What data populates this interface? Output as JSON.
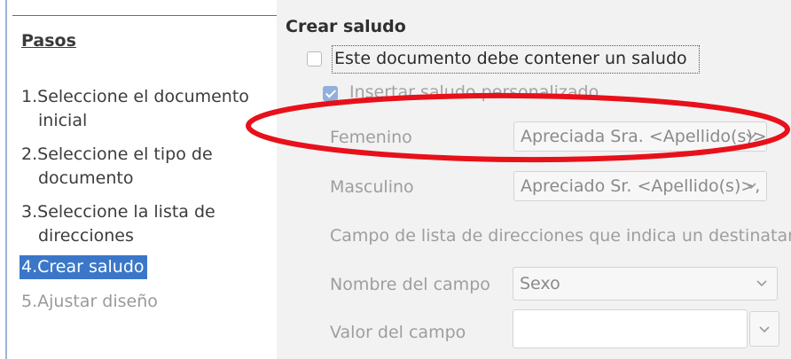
{
  "steps_panel": {
    "heading": "Pasos",
    "items": [
      {
        "num": "1.",
        "line1": "Seleccione el documento",
        "line2": "inicial"
      },
      {
        "num": "2.",
        "line1": "Seleccione el tipo de",
        "line2": "documento"
      },
      {
        "num": "3.",
        "line1": "Seleccione la lista de",
        "line2": "direcciones"
      },
      {
        "num": "4.",
        "line1": "Crear saludo"
      },
      {
        "num": "5.",
        "line1": "Ajustar diseño"
      }
    ]
  },
  "greeting": {
    "title": "Crear saludo",
    "contain_salutation_label": "Este documento debe contener un saludo",
    "personalized_label": "Insertar saludo personalizado",
    "female_label": "Femenino",
    "female_value": "Apreciada Sra. <Apellido(s)>,",
    "male_label": "Masculino",
    "male_value": "Apreciado Sr. <Apellido(s)>,",
    "address_field_info": "Campo de lista de direcciones que indica un destinatario",
    "field_name_label": "Nombre del campo",
    "field_name_value": "Sexo",
    "field_value_label": "Valor del campo",
    "field_value_value": ""
  },
  "annotation": {
    "color": "#e8101a"
  }
}
